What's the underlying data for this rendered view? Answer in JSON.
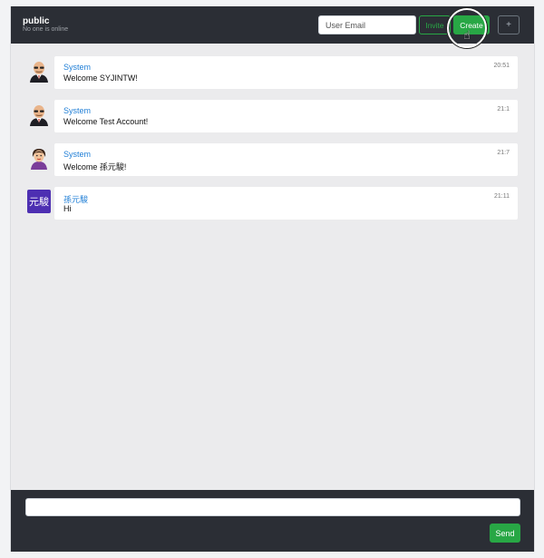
{
  "header": {
    "room_name": "public",
    "room_status": "No one is online",
    "email_placeholder": "User Email",
    "invite_label": "Invite",
    "create_label": "Create",
    "plus_label": "+"
  },
  "messages": [
    {
      "sender": "System",
      "text": "Welcome SYJINTW!",
      "time": "20:51",
      "avatar": "bald-man-avatar"
    },
    {
      "sender": "System",
      "text": "Welcome Test Account!",
      "time": "21:1",
      "avatar": "bald-man-avatar"
    },
    {
      "sender": "System",
      "text": "Welcome 孫元駿!",
      "time": "21:7",
      "avatar": "woman-avatar"
    },
    {
      "sender": "孫元駿",
      "text": "Hi",
      "time": "21:11",
      "avatar_text": "元駿"
    }
  ],
  "footer": {
    "input_value": "",
    "send_label": "Send"
  },
  "colors": {
    "header_bg": "#2b2e35",
    "accent_green": "#28a745",
    "sender_blue": "#1f7ed6",
    "avatar_purple": "#4d2fb2"
  }
}
